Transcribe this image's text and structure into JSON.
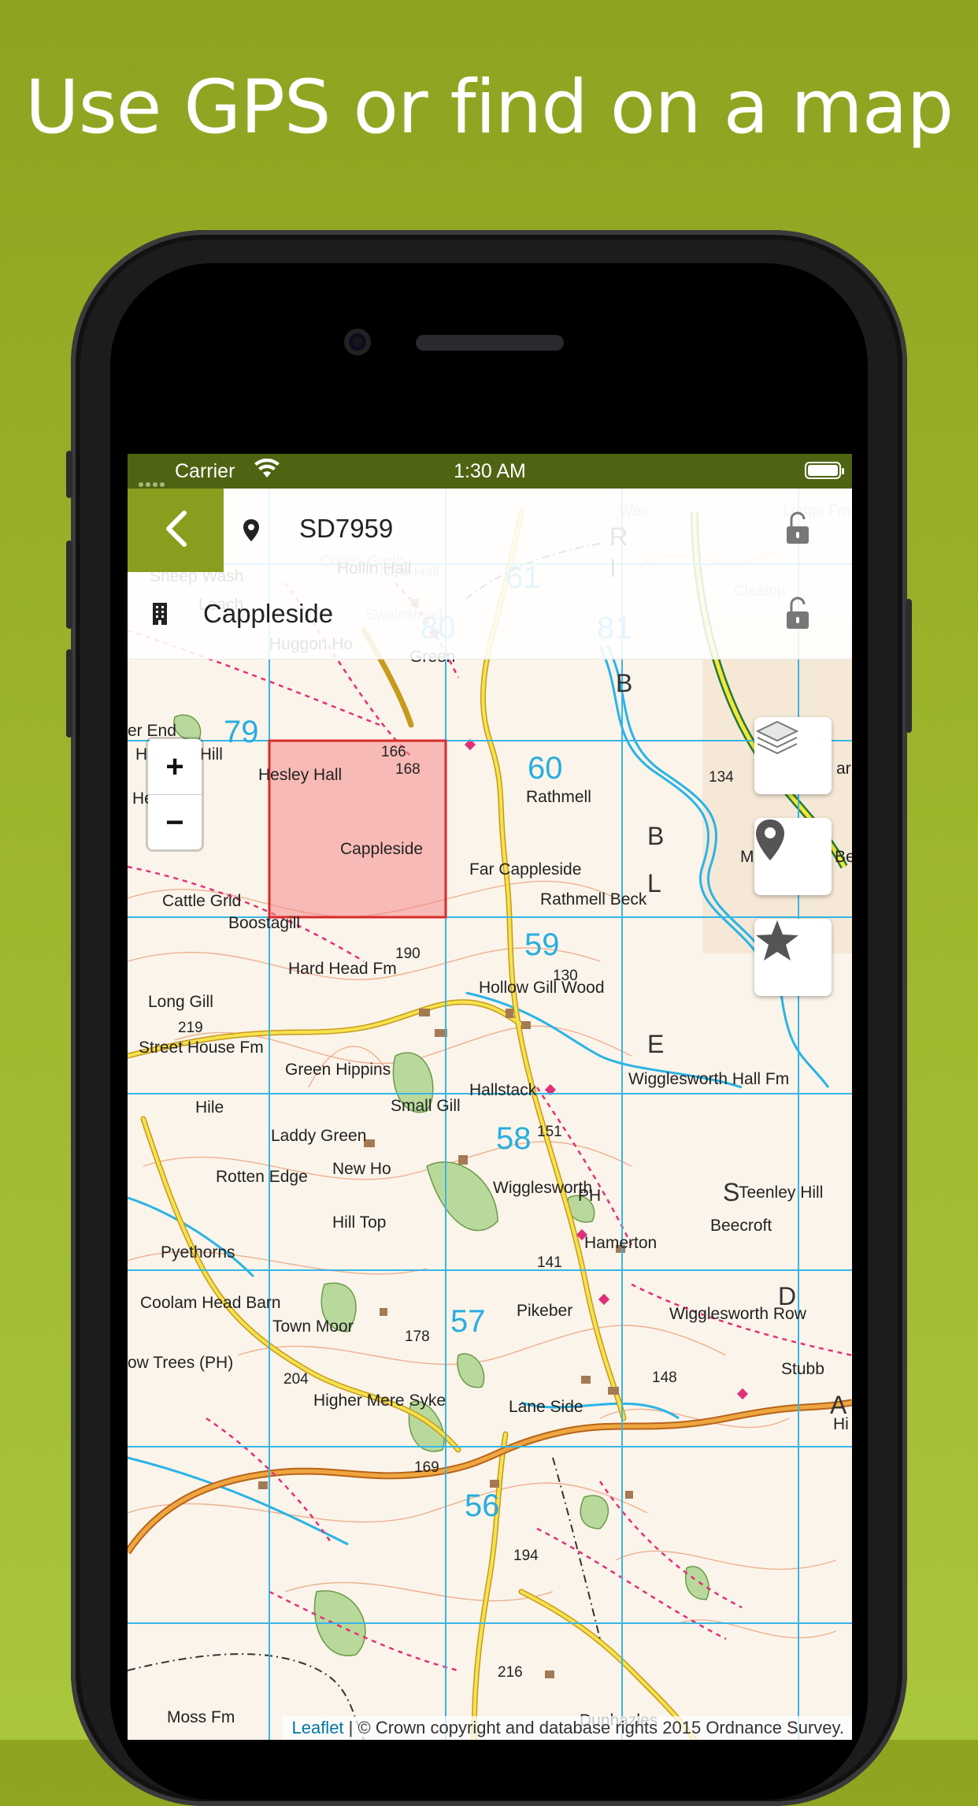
{
  "headline": "Use GPS or find on a map",
  "status_bar": {
    "carrier": "Carrier",
    "time": "1:30 AM"
  },
  "location": {
    "grid_ref": "SD7959",
    "place_name": "Cappleside"
  },
  "map": {
    "attribution_link": "Leaflet",
    "attribution_separator": "|",
    "attribution_text": "© Crown copyright and database rights 2015 Ordnance Survey.",
    "grid_numbers": [
      "61",
      "80",
      "81",
      "79",
      "60",
      "59",
      "58",
      "57",
      "56"
    ],
    "place_labels": [
      "Sheep Wash",
      "Leach",
      "Hollin Hall",
      "Huggon Ho",
      "Green",
      "er End",
      "Hensley Hill",
      "Hesley Hall",
      "Hesley",
      "Rathmell",
      "Cappleside",
      "Far Cappleside",
      "Rathmell Beck",
      "Cattle Grid",
      "Boostagill",
      "Hard Head Fm",
      "Hollow Gill Wood",
      "Long Gill",
      "Street House Fm",
      "Green Hippins",
      "Hallstack",
      "Wigglesworth Hall Fm",
      "Hile",
      "Small Gill",
      "Laddy Green",
      "New Ho",
      "Rotten Edge",
      "Wigglesworth",
      "PH",
      "Teenley Hill",
      "Beecroft",
      "Hill Top",
      "Hamerton",
      "Pyethorns",
      "Coolam Head Barn",
      "Town Moor",
      "Pikeber",
      "Wigglesworth Row",
      "ow Trees (PH)",
      "Higher Mere Syke",
      "Lane Side",
      "Stubb",
      "Moss Fm",
      "Dunhazles",
      "Skir Beck",
      "MP",
      "Hi",
      "arb"
    ],
    "spot_heights": [
      "166",
      "168",
      "134",
      "219",
      "151",
      "141",
      "178",
      "204",
      "148",
      "169",
      "194",
      "216",
      "130",
      "190"
    ],
    "river_letters": [
      "R",
      "I",
      "B",
      "B",
      "L",
      "E",
      "S",
      "D",
      "A"
    ],
    "faded_labels": [
      "Weir",
      "Lodge Fm",
      "Coney Garth",
      "New Hall",
      "Swainstead",
      "Cleatop"
    ],
    "colors": {
      "header_green": "#8a9d1e",
      "status_green": "#4f6412",
      "grid_blue": "#37b6e6",
      "selection_fill": "#f58a8a",
      "selection_stroke": "#d92b2b"
    }
  },
  "icons": {
    "back": "chevron-left-icon",
    "pin": "map-pin-icon",
    "building": "building-icon",
    "lock": "unlock-icon",
    "layers": "layers-icon",
    "locate": "location-pin-icon",
    "favourite": "star-icon"
  }
}
